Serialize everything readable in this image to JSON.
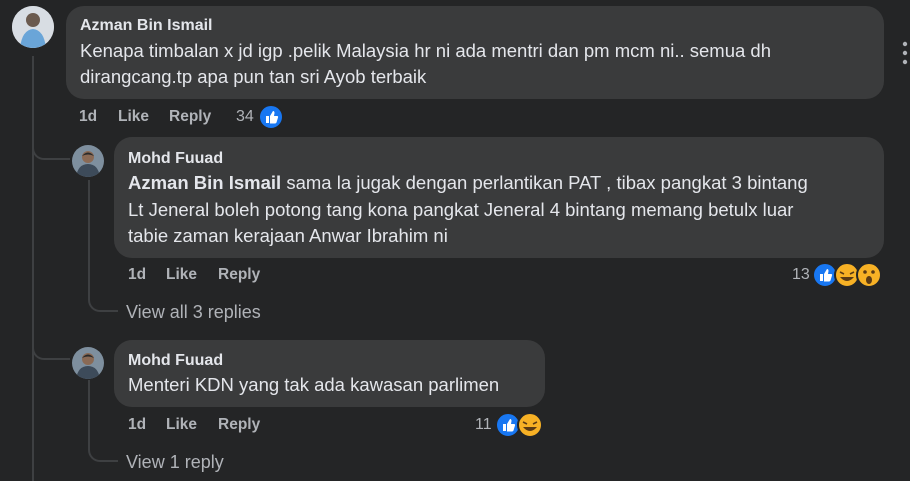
{
  "comments": [
    {
      "author": "Azman Bin Ismail",
      "text_line1": "Kenapa timbalan x jd igp .pelik Malaysia hr ni ada mentri dan pm mcm ni.. semua dh",
      "text_line2": "dirangcang.tp apa pun tan sri Ayob terbaik",
      "time": "1d",
      "like_label": "Like",
      "reply_label": "Reply",
      "reaction_count": "34"
    },
    {
      "author": "Mohd Fuuad",
      "mention": "Azman Bin Ismail",
      "text_line1": " sama la jugak dengan perlantikan PAT , tibax pangkat 3 bintang",
      "text_line2": "Lt Jeneral boleh potong tang kona pangkat Jeneral 4 bintang memang betulx luar",
      "text_line3": "tabie zaman kerajaan Anwar Ibrahim ni",
      "time": "1d",
      "like_label": "Like",
      "reply_label": "Reply",
      "reaction_count": "13",
      "view_replies": "View all 3 replies"
    },
    {
      "author": "Mohd Fuuad",
      "text_line1": "Menteri KDN yang tak ada kawasan parlimen",
      "time": "1d",
      "like_label": "Like",
      "reply_label": "Reply",
      "reaction_count": "11",
      "view_replies": "View 1 reply"
    }
  ],
  "colors": {
    "background": "#242526",
    "bubble": "#3a3b3c",
    "like_blue": "#1877f2",
    "emoji_yellow": "#f7b125"
  }
}
